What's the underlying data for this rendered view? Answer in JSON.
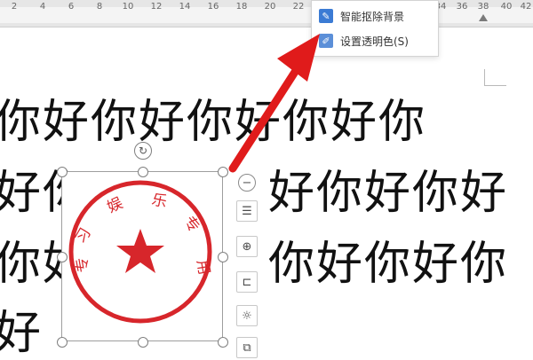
{
  "ruler": {
    "labels": [
      "2",
      "4",
      "6",
      "8",
      "10",
      "12",
      "14",
      "16",
      "18",
      "20",
      "22",
      "24",
      "34",
      "36",
      "38",
      "40",
      "42"
    ],
    "label_positions_note": ""
  },
  "document": {
    "row1": "你好你好你好你好你",
    "row2": "好你",
    "row2b": "好你好你好",
    "row3": "你好",
    "row3b": "你好你好你",
    "row4": "好",
    "row2_mid_obscured": "你好",
    "row3_mid_obscured": "你好"
  },
  "stamp": {
    "arc_text": "习 娱 乐 专 用",
    "char_1": "习",
    "char_2": "娱",
    "char_3": "乐",
    "char_4": "专",
    "char_5": "用",
    "char_left": "专",
    "color": "#d7262b"
  },
  "context_menu": {
    "item_1": "智能抠除背景",
    "item_2": "设置透明色(S)"
  },
  "colors": {
    "arrow": "#e01b1b",
    "stamp_red": "#d7262b",
    "menu_icon_blue": "#3b7bd4"
  },
  "icons": {
    "rotate": "rotate-icon",
    "minus": "minus-icon",
    "layout": "layout-options-icon",
    "zoom": "zoom-in-icon",
    "crop": "crop-icon",
    "idea": "lightbulb-icon",
    "more": "more-tools-icon"
  }
}
